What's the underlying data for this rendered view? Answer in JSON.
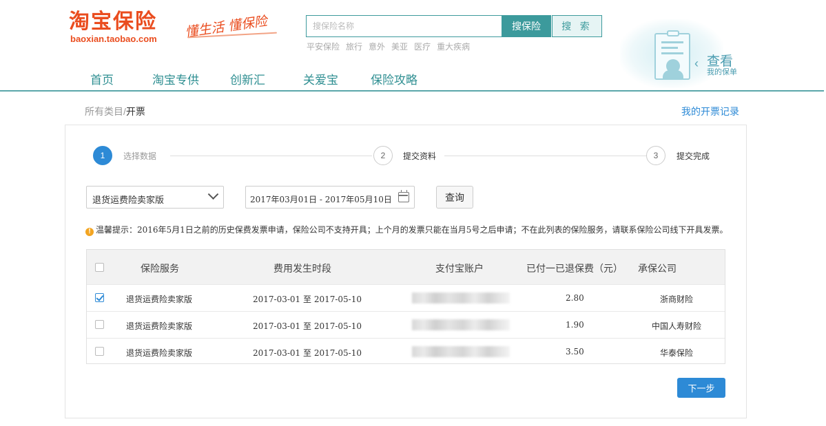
{
  "brand": {
    "name": "淘宝保险",
    "domain": "baoxian.taobao.com",
    "slogan": "懂生活 懂保险"
  },
  "search": {
    "placeholder": "搜保险名称",
    "search_insurance_label": "搜保险",
    "search_label": "搜 索",
    "hot_words": [
      "平安保险",
      "旅行",
      "意外",
      "美亚",
      "医疗",
      "重大疾病"
    ]
  },
  "policy_entry": {
    "title": "查看",
    "subtitle": "我的保单"
  },
  "nav": [
    "首页",
    "淘宝专供",
    "创新汇",
    "关爱宝",
    "保险攻略"
  ],
  "breadcrumb": {
    "parent": "所有类目",
    "current": "开票"
  },
  "record_link": "我的开票记录",
  "steps": [
    {
      "num": "1",
      "label": "选择数据",
      "active": true
    },
    {
      "num": "2",
      "label": "提交资料",
      "active": false
    },
    {
      "num": "3",
      "label": "提交完成",
      "active": false
    }
  ],
  "filters": {
    "product": "退货运费险卖家版",
    "date_range": "2017年03月01日 - 2017年05月10日",
    "query_label": "查询"
  },
  "tip": {
    "icon": "warning-icon",
    "text": "温馨提示：2016年5月1日之前的历史保费发票申请，保险公司不支持开具；上个月的发票只能在当月5号之后申请；不在此列表的保险服务，请联系保险公司线下开具发票。"
  },
  "table": {
    "headers": [
      "保险服务",
      "费用发生时段",
      "支付宝账户",
      "已付一已退保费（元）",
      "承保公司"
    ],
    "rows": [
      {
        "checked": true,
        "service": "退货运费险卖家版",
        "period": "2017-03-01 至 2017-05-10",
        "amount": "2.80",
        "company": "浙商财险"
      },
      {
        "checked": false,
        "service": "退货运费险卖家版",
        "period": "2017-03-01 至 2017-05-10",
        "amount": "1.90",
        "company": "中国人寿财险"
      },
      {
        "checked": false,
        "service": "退货运费险卖家版",
        "period": "2017-03-01 至 2017-05-10",
        "amount": "3.50",
        "company": "华泰保险"
      }
    ]
  },
  "next_label": "下一步",
  "colors": {
    "brand_orange": "#ea4d1f",
    "teal": "#3c9a9c",
    "primary_blue": "#2d8ad6"
  }
}
